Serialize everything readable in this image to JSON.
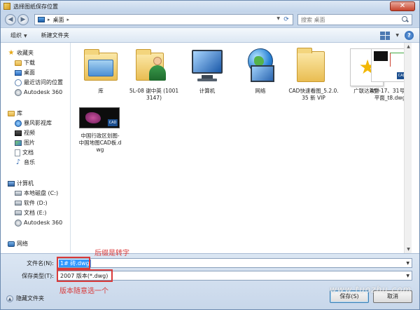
{
  "window": {
    "title": "选择图纸保存位置",
    "close_glyph": "✕"
  },
  "address": {
    "crumbs": [
      "桌面"
    ],
    "search_placeholder": "搜索 桌面"
  },
  "toolbar": {
    "organize": "组织",
    "new_folder": "新建文件夹"
  },
  "sidebar": {
    "favorites": {
      "header": "收藏夹",
      "items": [
        "下载",
        "桌面",
        "最近访问的位置",
        "Autodesk 360"
      ]
    },
    "libraries": {
      "header": "库",
      "items": [
        "暴风影视库",
        "视频",
        "图片",
        "文档",
        "音乐"
      ]
    },
    "computer": {
      "header": "计算机",
      "items": [
        "本地磁盘 (C:)",
        "软件 (D:)",
        "文档 (E:)",
        "Autodesk 360"
      ]
    },
    "network": {
      "header": "网络"
    }
  },
  "files": [
    {
      "label": "库",
      "icon": "library-folder"
    },
    {
      "label": "5L-08 谢中英 (10013147)",
      "icon": "user-folder"
    },
    {
      "label": "计算机",
      "icon": "computer"
    },
    {
      "label": "网络",
      "icon": "network-globe"
    },
    {
      "label": "CAD快速看图_5.2.0.35 新 VIP",
      "icon": "folder"
    },
    {
      "label": "广联达软件",
      "icon": "star-shortcut"
    },
    {
      "label": "A型-17、31号楼平面_t8.dwg",
      "icon": "dwg-thumbnail"
    },
    {
      "label": "中国行政区划图-中国地图CAD板.dwg",
      "icon": "dwg-map-thumbnail"
    }
  ],
  "thumb_badge": "CAD",
  "bottom": {
    "filename_label": "文件名(N):",
    "filename_value": "1# 砖.dwg",
    "type_label": "保存类型(T):",
    "type_value": "2007 版本(*.dwg)",
    "hide_folders": "隐藏文件夹",
    "save_button": "保存(S)",
    "cancel_button": "取消"
  },
  "annotations": {
    "suffix_note": "后缀是转字",
    "version_note": "版本随意选一个"
  },
  "watermark": "www.tuozhu.com",
  "colors": {
    "annotation_red": "#d93a3a",
    "selection_blue": "#3399ff"
  }
}
